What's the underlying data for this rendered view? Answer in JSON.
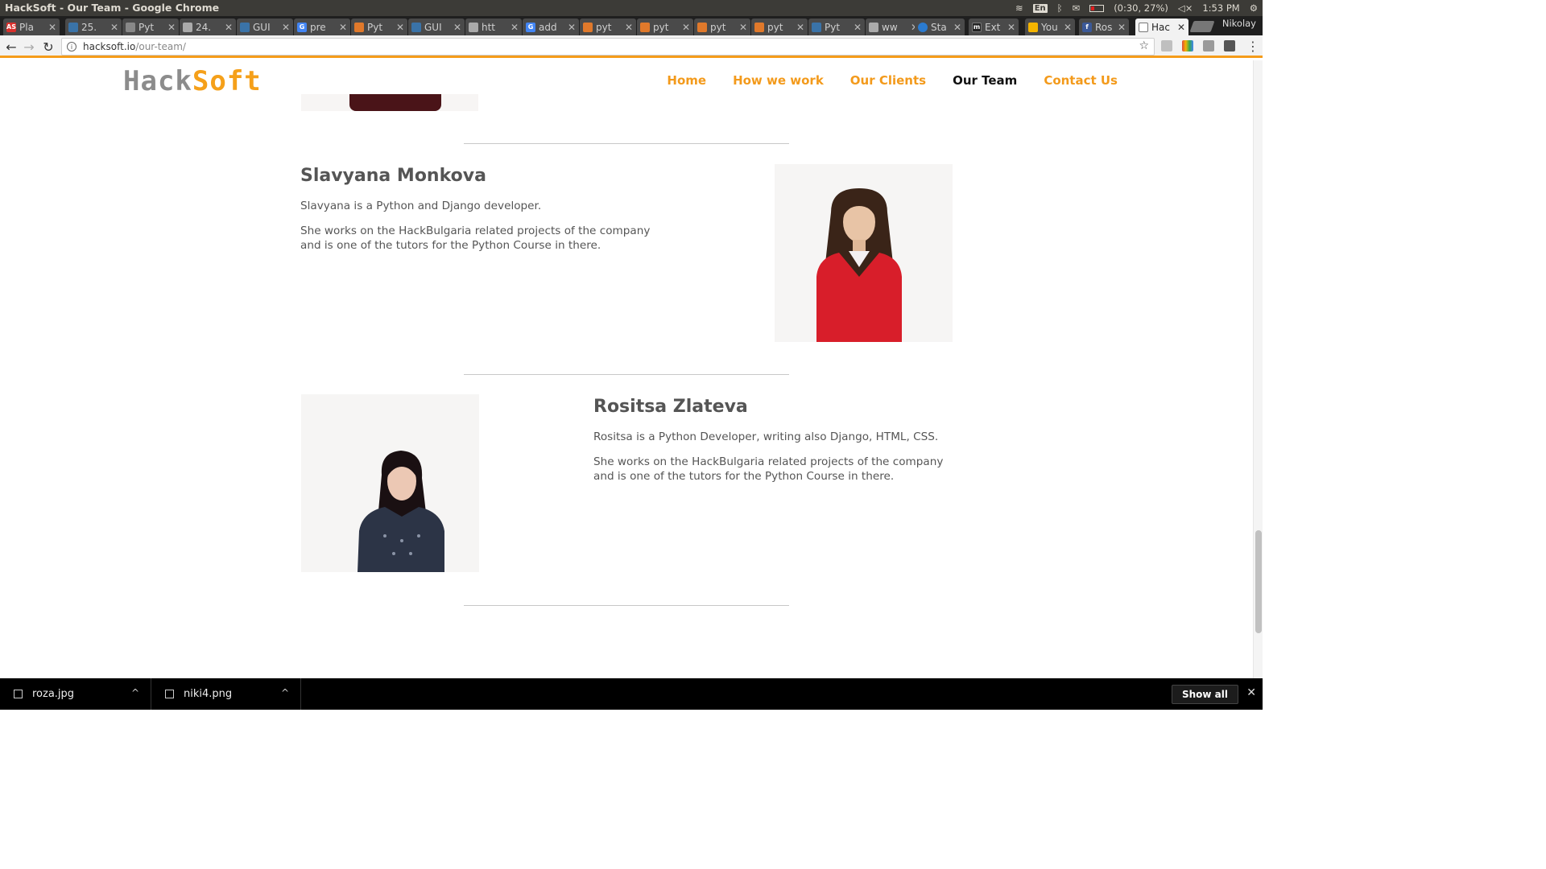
{
  "os": {
    "window_title": "HackSoft - Our Team - Google Chrome",
    "keyboard": "En",
    "battery": "(0:30, 27%)",
    "time": "1:53 PM"
  },
  "browser": {
    "tabs": [
      {
        "label": "Pla",
        "icon": "as-icon",
        "color": "#d9302c"
      },
      {
        "label": "25.",
        "icon": "python-icon",
        "color": "#3a73a8"
      },
      {
        "label": "Pyt",
        "icon": "compass-icon",
        "color": "#888888"
      },
      {
        "label": "24.",
        "icon": "page-icon",
        "color": "#aaaaaa"
      },
      {
        "label": "GUI",
        "icon": "python-icon",
        "color": "#3a73a8"
      },
      {
        "label": "pre",
        "icon": "google-icon",
        "color": "#4285f4"
      },
      {
        "label": "Pyt",
        "icon": "stack-icon",
        "color": "#e0792b"
      },
      {
        "label": "GUI",
        "icon": "python-icon",
        "color": "#3a73a8"
      },
      {
        "label": "htt",
        "icon": "page-icon",
        "color": "#aaaaaa"
      },
      {
        "label": "add",
        "icon": "google-icon",
        "color": "#4285f4"
      },
      {
        "label": "pyt",
        "icon": "stack-icon",
        "color": "#e0792b"
      },
      {
        "label": "pyt",
        "icon": "stack-icon",
        "color": "#e0792b"
      },
      {
        "label": "pyt",
        "icon": "stack-icon",
        "color": "#e0792b"
      },
      {
        "label": "pyt",
        "icon": "stack-icon",
        "color": "#e0792b"
      },
      {
        "label": "Pyt",
        "icon": "python-icon",
        "color": "#3a73a8"
      },
      {
        "label": "ww",
        "icon": "page-icon",
        "color": "#aaaaaa"
      },
      {
        "label": "Sta",
        "icon": "globe-icon",
        "color": "#2b7bd0"
      },
      {
        "label": "Ext",
        "icon": "m-icon",
        "color": "#222222"
      },
      {
        "label": "You",
        "icon": "slides-icon",
        "color": "#f4b400"
      },
      {
        "label": "Ros",
        "icon": "facebook-icon",
        "color": "#3b5998"
      },
      {
        "label": "Hac",
        "icon": "page-icon",
        "color": "#cccccc",
        "active": true
      }
    ],
    "profile": "Nikolay",
    "url_domain": "hacksoft.io",
    "url_path": "/our-team/"
  },
  "site": {
    "logo_part1": "Hack",
    "logo_part2": "Soft",
    "nav": {
      "home": "Home",
      "how": "How we work",
      "clients": "Our Clients",
      "team": "Our Team",
      "contact": "Contact Us"
    },
    "accent": "#f39a1b"
  },
  "members": [
    {
      "name": "Slavyana Monkova",
      "intro": "Slavyana is a Python and Django developer.",
      "bio": "She works on the HackBulgaria related projects of the company and is one of the tutors for the Python Course in there."
    },
    {
      "name": "Rositsa Zlateva",
      "intro": "Rositsa is a Python Developer, writing also Django, HTML, CSS.",
      "bio": "She works on the HackBulgaria related projects of the company and is one of the tutors for the Python Course in there."
    }
  ],
  "downloads": {
    "items": [
      {
        "filename": "roza.jpg"
      },
      {
        "filename": "niki4.png"
      }
    ],
    "show_all": "Show all"
  }
}
